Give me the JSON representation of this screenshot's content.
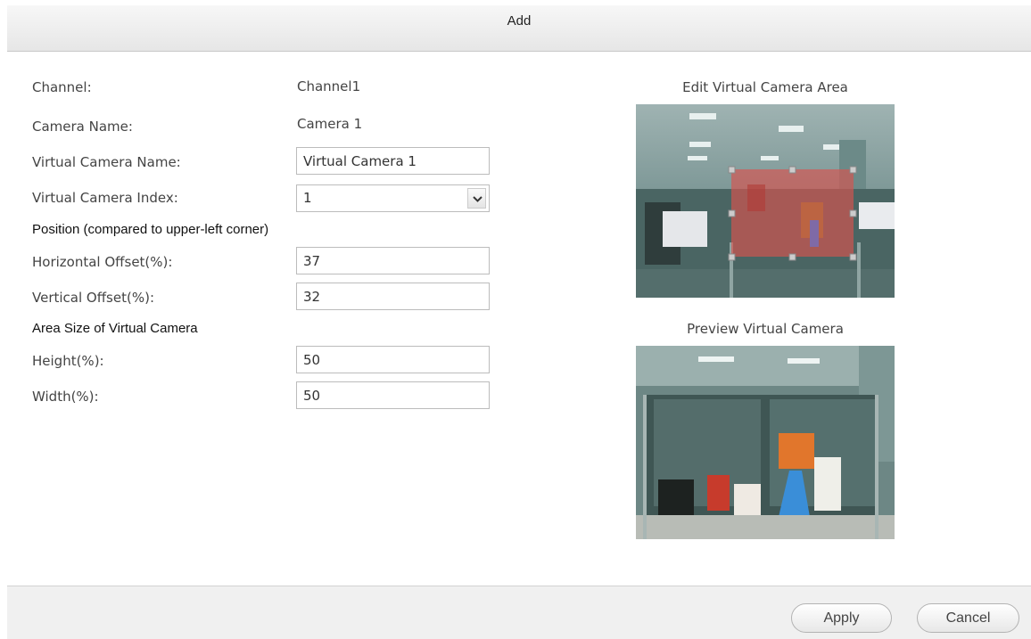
{
  "dialog": {
    "title": "Add"
  },
  "form": {
    "channel_label": "Channel:",
    "channel_value": "Channel1",
    "camera_name_label": "Camera Name:",
    "camera_name_value": "Camera 1",
    "virtual_camera_name_label": "Virtual Camera Name:",
    "virtual_camera_name_value": "Virtual Camera 1",
    "virtual_camera_index_label": "Virtual Camera Index:",
    "virtual_camera_index_value": "1",
    "position_heading": "Position (compared to upper-left corner)",
    "horizontal_offset_label": "Horizontal Offset(%):",
    "horizontal_offset_value": "37",
    "vertical_offset_label": "Vertical Offset(%):",
    "vertical_offset_value": "32",
    "area_size_heading": "Area Size of Virtual Camera",
    "height_label": "Height(%):",
    "height_value": "50",
    "width_label": "Width(%):",
    "width_value": "50"
  },
  "edit_area": {
    "title": "Edit Virtual Camera Area"
  },
  "preview": {
    "title": "Preview Virtual Camera"
  },
  "footer": {
    "apply_label": "Apply",
    "cancel_label": "Cancel"
  },
  "colors": {
    "selection_overlay": "#d9534f",
    "handle": "#cccccc"
  },
  "icons": {
    "dropdown": "chevron-down-icon"
  }
}
